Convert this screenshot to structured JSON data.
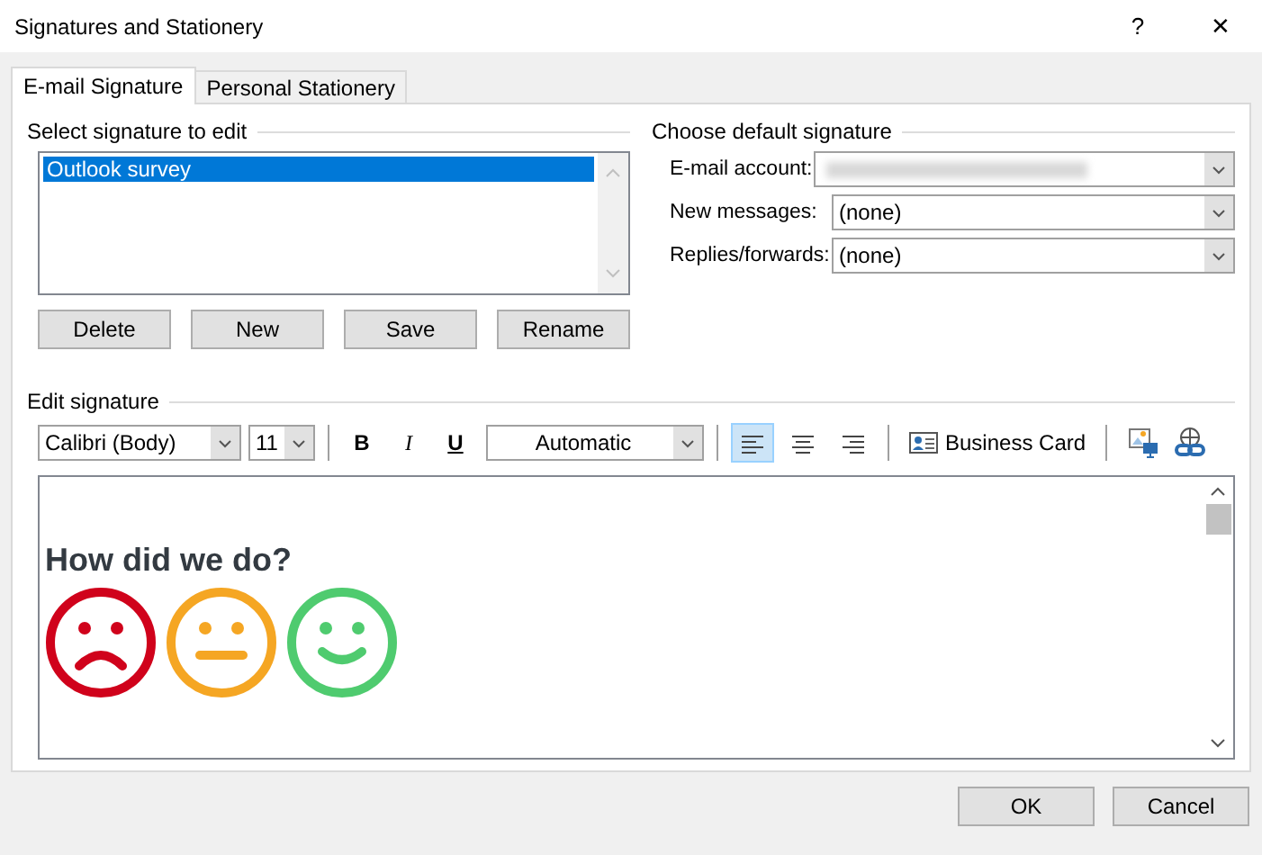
{
  "window": {
    "title": "Signatures and Stationery",
    "help": "?",
    "close": "✕"
  },
  "tabs": [
    {
      "label": "E-mail Signature",
      "selected": true
    },
    {
      "label": "Personal Stationery",
      "selected": false
    }
  ],
  "select_signature": {
    "heading": "Select signature to edit",
    "items": [
      {
        "label": "Outlook survey",
        "selected": true
      }
    ],
    "buttons": [
      "Delete",
      "New",
      "Save",
      "Rename"
    ]
  },
  "default_signature": {
    "heading": "Choose default signature",
    "fields": [
      {
        "label": "E-mail account:",
        "redacted": true
      },
      {
        "label": "New messages:",
        "value": "(none)",
        "redacted": false
      },
      {
        "label": "Replies/forwards:",
        "value": "(none)",
        "redacted": false
      }
    ]
  },
  "edit_signature": {
    "heading": "Edit signature",
    "font": "Calibri (Body)",
    "size": "11",
    "color_choice": "Automatic",
    "styles": [
      {
        "kind": "bold",
        "label": "B"
      },
      {
        "kind": "italic",
        "label": "I"
      },
      {
        "kind": "underline",
        "label": "U"
      }
    ],
    "align": [
      {
        "kind": "left",
        "selected": true
      },
      {
        "kind": "center",
        "selected": false
      },
      {
        "kind": "right",
        "selected": false
      }
    ],
    "business_card": "Business Card",
    "content": {
      "heading": "How did we do?",
      "faces": [
        {
          "kind": "sad",
          "color": "#d0021b"
        },
        {
          "kind": "neutral",
          "color": "#f5a623"
        },
        {
          "kind": "happy",
          "color": "#4fcb6f"
        }
      ]
    }
  },
  "footer_buttons": [
    "OK",
    "Cancel"
  ]
}
